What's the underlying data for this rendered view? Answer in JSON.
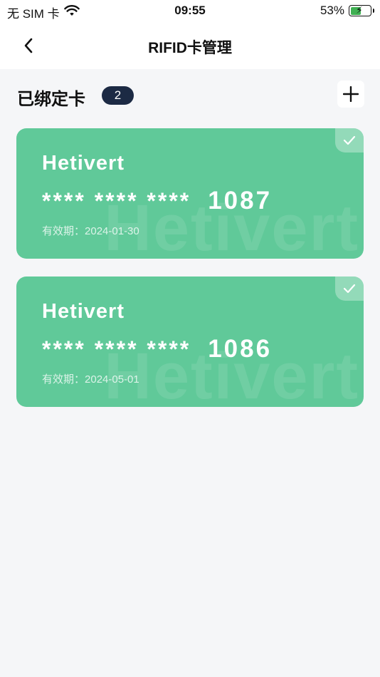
{
  "status_bar": {
    "carrier": "无 SIM 卡",
    "time": "09:55",
    "battery": "53%",
    "battery_level": 0.53
  },
  "header": {
    "title": "RIFID卡管理"
  },
  "section": {
    "title": "已绑定卡",
    "count": "2"
  },
  "cards": [
    {
      "brand": "Hetivert",
      "mask": "**** **** ****",
      "last4": "1087",
      "expiry_label": "有效期：",
      "expiry": "2024-01-30",
      "selected": true
    },
    {
      "brand": "Hetivert",
      "mask": "**** **** ****",
      "last4": "1086",
      "expiry_label": "有效期：",
      "expiry": "2024-05-01",
      "selected": true
    }
  ],
  "colors": {
    "card": "#60c999",
    "badge": "#1c2a44",
    "background": "#f5f6f8"
  },
  "icons": [
    "wifi-icon",
    "battery-icon",
    "back-chevron-icon",
    "plus-icon",
    "check-icon"
  ]
}
